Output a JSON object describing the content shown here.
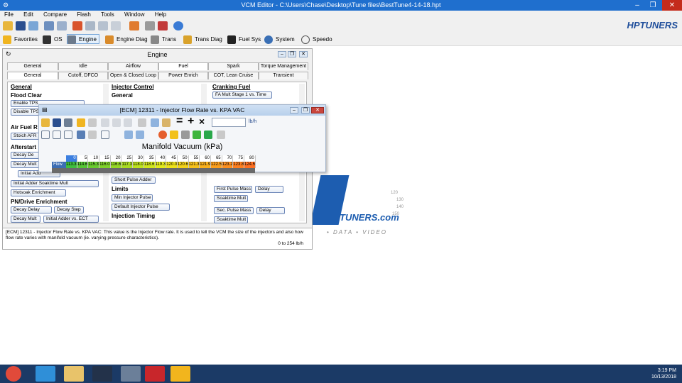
{
  "window": {
    "title": "VCM Editor - C:\\Users\\Chase\\Desktop\\Tune files\\BestTune4-14-18.hpt",
    "minimize": "–",
    "restore": "❐",
    "close": "✕"
  },
  "menu": [
    "File",
    "Edit",
    "Compare",
    "Flash",
    "Tools",
    "Window",
    "Help"
  ],
  "toolbar2": [
    "Favorites",
    "OS",
    "Engine",
    "Engine Diag",
    "Trans",
    "Trans Diag",
    "Fuel Sys",
    "System",
    "Speedo"
  ],
  "brand": {
    "text": "HPTUNERS",
    "accent": "#1f4e9b"
  },
  "engine": {
    "title": "Engine",
    "tabs_top": [
      "General",
      "Idle",
      "Airflow",
      "Fuel",
      "Spark",
      "Torque Management"
    ],
    "tabs_bottom": [
      "General",
      "Cutoff, DFCO",
      "Open & Closed Loop",
      "Power Enrich",
      "COT, Lean Cruise",
      "Transient"
    ],
    "col1": {
      "title": "General",
      "flood": "Flood Clear",
      "b1": "Enable TPS",
      "b2": "Disable TPS",
      "afr": "Air Fuel R",
      "b3": "Stoich AFR",
      "after": "Afterstart",
      "b4": "Decay De",
      "b5": "Decay Mult",
      "b6": "Initial Add",
      "b7": "Initial Adder Soaktime Mult",
      "b8": "Hotsoak Enrichment",
      "pn": "PN/Drive Enrichment",
      "b9": "Decay Delay",
      "b10": "Decay Step",
      "b11": "Decay Mult",
      "b12": "Initial Adder vs. ECT"
    },
    "col2": {
      "title": "Injector Control",
      "gen": "General",
      "b1": "Short Pulse Adder",
      "limits": "Limits",
      "b2": "Min Injector Pulse",
      "b3": "Default Injector Pulse",
      "timing": "Injection Timing"
    },
    "col3": {
      "title": "Cranking Fuel",
      "b1": "FA Mult Stage 1 vs. Time",
      "b2": "First Pulse Mass",
      "b3": "Delay",
      "b4": "Soaktime Mult",
      "b5": "Sec. Pulse Mass",
      "b6": "Delay",
      "b7": "Soaktime Mult"
    },
    "description": "[ECM] 12311 - Injector Flow Rate vs. KPA VAC: This value is the Injector Flow rate. It is used to tell the VCM the size of the injectors and also how flow rate varies with manifold vacuum (ie. varying pressure characteristics).",
    "range": "0 to 254 lb/h"
  },
  "table": {
    "title": "[ECM] 12311 - Injector Flow Rate vs. KPA VAC",
    "unit": "lb/h",
    "input_value": "",
    "axis_label": "Manifold Vacuum (kPa)",
    "row_label": "Flow",
    "columns": [
      "0",
      "5",
      "10",
      "15",
      "20",
      "25",
      "30",
      "35",
      "40",
      "45",
      "50",
      "55",
      "60",
      "65",
      "70",
      "75",
      "80"
    ],
    "values": [
      "113.3",
      "114.6",
      "115.3",
      "116.0",
      "116.6",
      "117.3",
      "118.0",
      "118.6",
      "119.3",
      "120.0",
      "120.6",
      "121.3",
      "121.9",
      "122.5",
      "123.2",
      "123.8",
      "124.5"
    ],
    "colors": [
      "#3fbf3f",
      "#55c535",
      "#6acb2f",
      "#7fd12a",
      "#95d726",
      "#a9dc22",
      "#bde21f",
      "#d0e61d",
      "#e2ea1b",
      "#eee21a",
      "#f3d21b",
      "#f7c11c",
      "#f9b01d",
      "#fb9f1e",
      "#fc8f1f",
      "#fd7f20",
      "#fe7021"
    ]
  },
  "watermark": {
    "brand": "TUNERS.com",
    "tag": "• DATA • VIDEO",
    "speeds": [
      "120",
      "130",
      "140",
      "150"
    ]
  },
  "clock": {
    "time": "3:19 PM",
    "date": "10/13/2018"
  }
}
